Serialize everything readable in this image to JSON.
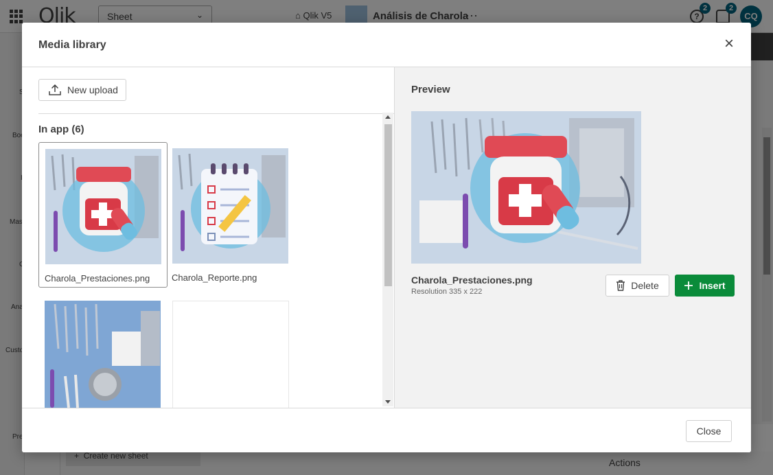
{
  "background": {
    "sheet_dropdown": "Sheet",
    "space_label": "Qlik V5",
    "app_title": "Análisis de Charola",
    "more_dots": "···",
    "help_badge": "2",
    "notif_badge": "2",
    "user_initials": "CQ",
    "create_sheet": "Create new sheet",
    "actions_label": "Actions",
    "left_labels": [
      "S",
      "Boo",
      "I",
      "Mas",
      "C",
      "Ana",
      "Custo",
      "Pre"
    ]
  },
  "modal": {
    "title": "Media library",
    "close_icon": "×",
    "upload_label": "New upload",
    "section_label": "In app (6)",
    "files": [
      {
        "name": "Charola_Prestaciones.png",
        "selected": true
      },
      {
        "name": "Charola_Reporte.png",
        "selected": false
      },
      {
        "name": "",
        "selected": false
      },
      {
        "name": "",
        "selected": false
      }
    ],
    "preview": {
      "heading": "Preview",
      "file_name": "Charola_Prestaciones.png",
      "resolution": "Resolution 335 x 222",
      "delete_label": "Delete",
      "insert_label": "Insert"
    },
    "footer_close": "Close"
  },
  "colors": {
    "accent_green": "#0a8b3a",
    "badge_teal": "#006580"
  }
}
